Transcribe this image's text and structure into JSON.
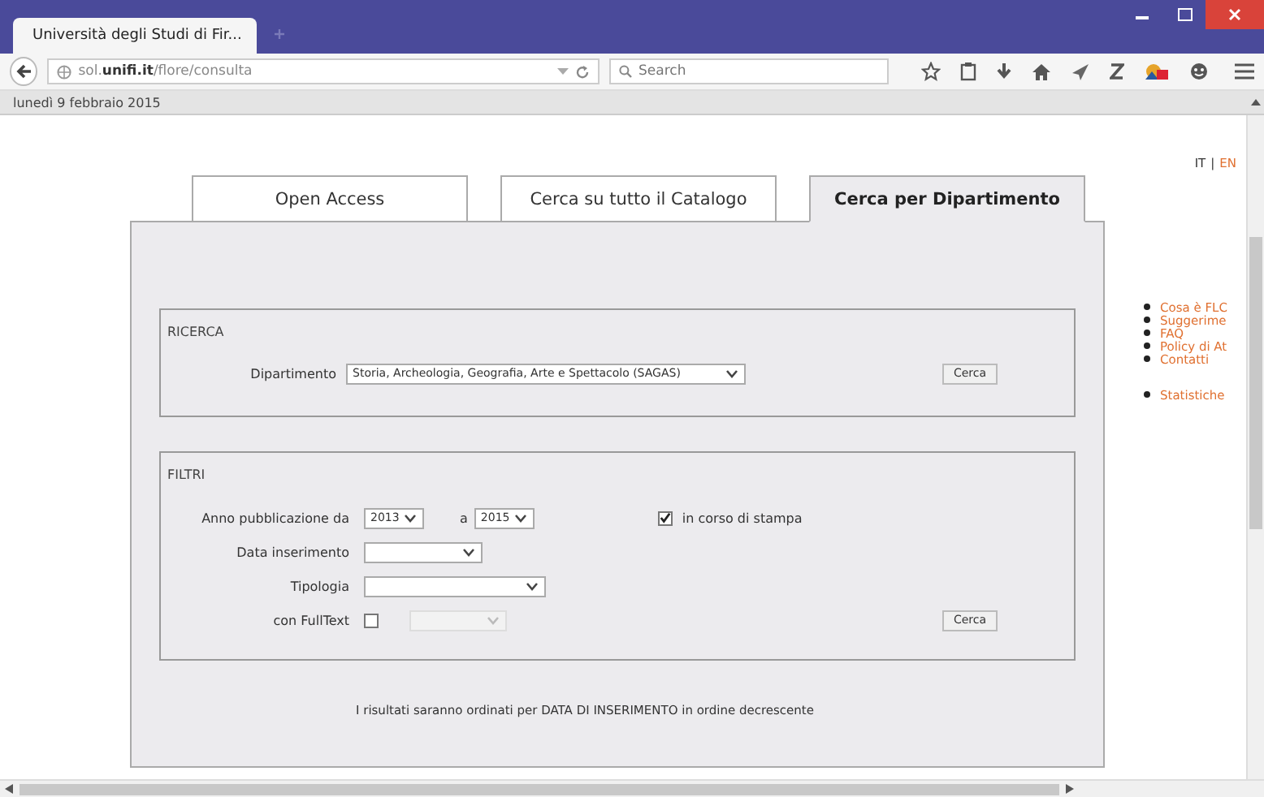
{
  "browser": {
    "tab_title": "Università degli Studi di Fir...",
    "url": "sol.**unifi.it**/flore/consulta",
    "search": {
      "placeholder": "Search"
    }
  },
  "date": "lunedì 9 febbraio 2015",
  "languages": [
    {
      "label": "IT",
      "selected": true
    },
    {
      "label": "EN",
      "selected": false
    }
  ],
  "language_separator": "|",
  "tabs": [
    {
      "label": "Open Access",
      "selected": false
    },
    {
      "label": "Cerca su tutto il Catalogo",
      "selected": false
    },
    {
      "label": "Cerca per Dipartimento",
      "selected": true
    }
  ],
  "ricerca": {
    "title": "RICERCA",
    "label": "Dipartimento",
    "value": "Storia, Archeologia, Geografia, Arte e Spettacolo (SAGAS)",
    "button": "Cerca"
  },
  "filtri": {
    "title": "FILTRI",
    "year_label": "Anno pubblicazione da",
    "year_from": "2013",
    "to_label": "a",
    "year_to": "2015",
    "in_press": {
      "label": "in corso di stampa",
      "checked": true
    },
    "date_label": "Data inserimento",
    "type_label": "Tipologia",
    "fulltext": {
      "label": "con FullText",
      "checked": false,
      "select_disabled": true
    },
    "button": "Cerca"
  },
  "note": "I risultati saranno ordinati per DATA DI INSERIMENTO in ordine decrescente",
  "sidebar": {
    "links": [
      "Cosa è FLC",
      "Suggerime",
      "FAQ",
      "Policy di At",
      "Contatti"
    ],
    "extra_links": [
      "Statistiche"
    ]
  }
}
